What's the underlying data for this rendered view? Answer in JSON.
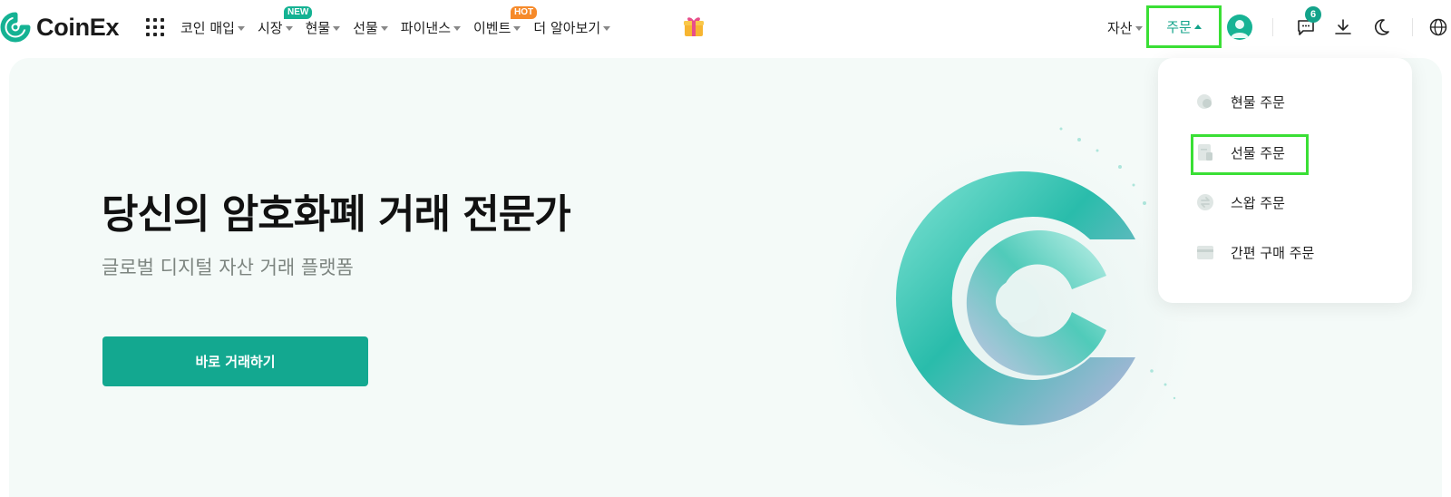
{
  "brand": {
    "name": "CoinEx"
  },
  "nav": {
    "apps_icon": "grid-dots-icon",
    "items": [
      {
        "label": "코인 매입",
        "badge": ""
      },
      {
        "label": "시장",
        "badge": "NEW"
      },
      {
        "label": "현물",
        "badge": ""
      },
      {
        "label": "선물",
        "badge": ""
      },
      {
        "label": "파이낸스",
        "badge": ""
      },
      {
        "label": "이벤트",
        "badge": "HOT"
      },
      {
        "label": "더 알아보기",
        "badge": ""
      }
    ],
    "gift_icon": "gift-icon",
    "assets_label": "자산",
    "orders_label": "주문",
    "message_count": "6"
  },
  "hero": {
    "title": "당신의 암호화폐 거래 전문가",
    "subtitle": "글로벌 디지털 자산 거래 플랫폼",
    "cta_label": "바로 거래하기"
  },
  "orders_menu": {
    "items": [
      {
        "label": "현물 주문",
        "icon": "spot-order-icon"
      },
      {
        "label": "선물 주문",
        "icon": "futures-order-icon"
      },
      {
        "label": "스왑 주문",
        "icon": "swap-order-icon"
      },
      {
        "label": "간편 구매 주문",
        "icon": "quick-buy-order-icon"
      }
    ]
  },
  "colors": {
    "brand_green": "#13a890",
    "hero_background": "#f4faf8",
    "hot_badge": "#f68a2a",
    "highlight_box": "#3adf35"
  }
}
